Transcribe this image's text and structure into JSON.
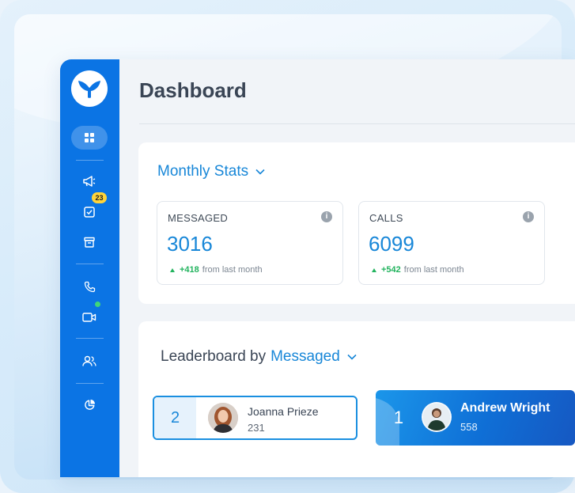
{
  "app": {
    "page_title": "Dashboard"
  },
  "sidebar": {
    "logo": "whale-tail-logo",
    "items": [
      {
        "name": "dashboard",
        "icon": "grid-icon",
        "active": true
      },
      {
        "name": "campaigns",
        "icon": "megaphone-icon"
      },
      {
        "name": "tasks",
        "icon": "checkbox-icon",
        "badge": "23"
      },
      {
        "name": "archive",
        "icon": "archive-box-icon"
      },
      {
        "name": "calls",
        "icon": "phone-icon"
      },
      {
        "name": "video",
        "icon": "video-camera-icon",
        "status": "online"
      },
      {
        "name": "contacts",
        "icon": "users-icon"
      },
      {
        "name": "reports",
        "icon": "pie-chart-icon"
      }
    ]
  },
  "monthly_stats": {
    "title": "Monthly Stats",
    "stats": [
      {
        "label": "MESSAGED",
        "value": "3016",
        "delta": "+418",
        "delta_suffix": "from last month"
      },
      {
        "label": "CALLS",
        "value": "6099",
        "delta": "+542",
        "delta_suffix": "from last month"
      }
    ]
  },
  "leaderboard": {
    "title_prefix": "Leaderboard by",
    "metric": "Messaged",
    "entries": [
      {
        "rank": "2",
        "name": "Joanna Prieze",
        "score": "231"
      },
      {
        "rank": "1",
        "name": "Andrew Wright",
        "score": "558"
      }
    ]
  },
  "colors": {
    "sidebar": "#0b74e4",
    "accent": "#1887d8",
    "positive": "#22b35e",
    "badge": "#ffd43b",
    "status_online": "#40d67a"
  }
}
